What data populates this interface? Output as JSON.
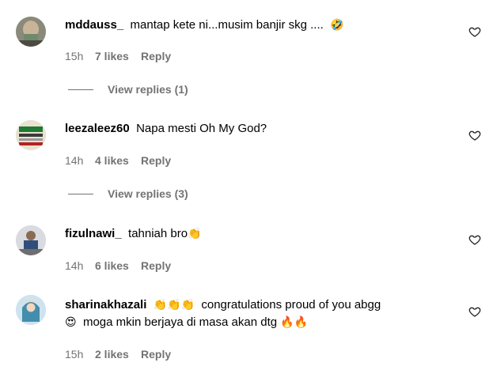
{
  "comments": [
    {
      "username": "mddauss_",
      "text": "mantap kete ni...musim banjir skg ....",
      "emoji": "🤣",
      "time": "15h",
      "likes": "7 likes",
      "reply": "Reply",
      "view_replies": "View replies (1)"
    },
    {
      "username": "leezaleez60",
      "text": "Napa mesti Oh My God?",
      "emoji": "",
      "time": "14h",
      "likes": "4 likes",
      "reply": "Reply",
      "view_replies": "View replies (3)"
    },
    {
      "username": "fizulnawi_",
      "text": "tahniah bro",
      "emoji": "👏",
      "time": "14h",
      "likes": "6 likes",
      "reply": "Reply",
      "view_replies": ""
    },
    {
      "username": "sharinakhazali",
      "emoji_lead": "👏👏👏",
      "text": "congratulations proud of you abgg",
      "emoji_line2": "😍",
      "text_line2": "moga mkin berjaya di masa akan dtg",
      "emoji_tail": "🔥🔥",
      "time": "15h",
      "likes": "2 likes",
      "reply": "Reply",
      "view_replies": ""
    }
  ],
  "colors": {
    "meta_text": "#737373",
    "username": "#000000"
  },
  "icons": [
    "heart-icon",
    "avatar"
  ]
}
